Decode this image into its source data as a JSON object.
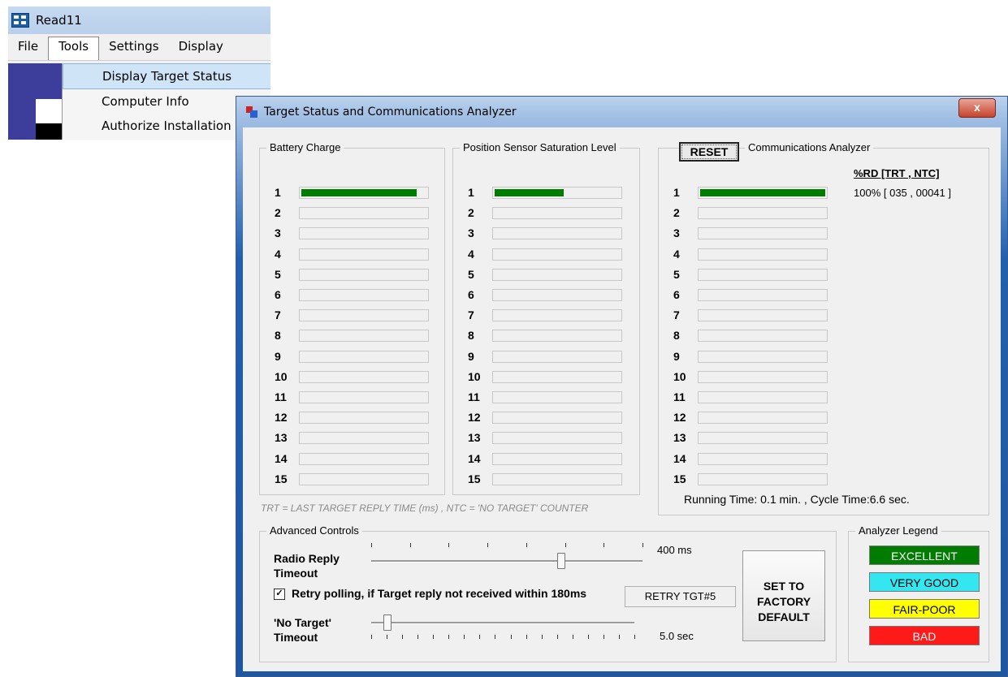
{
  "background_window": {
    "title": "Read11",
    "menu": [
      "File",
      "Tools",
      "Settings",
      "Display"
    ],
    "active_menu": "Tools",
    "dropdown_items": [
      "Display Target Status",
      "Computer Info",
      "Authorize Installation"
    ],
    "selected_item": "Display Target Status"
  },
  "dialog": {
    "title": "Target Status and Communications Analyzer",
    "close_label": "x",
    "battery": {
      "label": "Battery Charge",
      "rows": [
        "1",
        "2",
        "3",
        "4",
        "5",
        "6",
        "7",
        "8",
        "9",
        "10",
        "11",
        "12",
        "13",
        "14",
        "15"
      ],
      "levels": [
        0.92,
        0,
        0,
        0,
        0,
        0,
        0,
        0,
        0,
        0,
        0,
        0,
        0,
        0,
        0
      ]
    },
    "position": {
      "label": "Position Sensor Saturation Level",
      "rows": [
        "1",
        "2",
        "3",
        "4",
        "5",
        "6",
        "7",
        "8",
        "9",
        "10",
        "11",
        "12",
        "13",
        "14",
        "15"
      ],
      "levels": [
        0.55,
        0,
        0,
        0,
        0,
        0,
        0,
        0,
        0,
        0,
        0,
        0,
        0,
        0,
        0
      ]
    },
    "comm": {
      "label": "Communications Analyzer",
      "reset_label": "RESET",
      "rows": [
        "1",
        "2",
        "3",
        "4",
        "5",
        "6",
        "7",
        "8",
        "9",
        "10",
        "11",
        "12",
        "13",
        "14",
        "15"
      ],
      "levels": [
        1.0,
        0,
        0,
        0,
        0,
        0,
        0,
        0,
        0,
        0,
        0,
        0,
        0,
        0,
        0
      ],
      "header": "%RD [TRT ,  NTC]",
      "value": "100% [ 035 , 00041 ]",
      "running": "Running Time: 0.1 min. , Cycle Time:6.6 sec."
    },
    "note": "TRT = LAST TARGET REPLY TIME (ms) , NTC = 'NO TARGET' COUNTER",
    "advanced": {
      "label": "Advanced Controls",
      "radio_label_1": "Radio Reply",
      "radio_label_2": "Timeout",
      "radio_value": "400 ms",
      "radio_level": 0.7,
      "retry_text": "Retry polling, if Target reply not received within 180ms",
      "retry_checked": true,
      "check_mark": "✓",
      "retry_box": "RETRY TGT#5",
      "notarget_label_1": "'No Target'",
      "notarget_label_2": "Timeout",
      "notarget_value": "5.0 sec",
      "notarget_level": 0.03,
      "factory_lines": [
        "SET TO",
        "FACTORY",
        "DEFAULT"
      ]
    },
    "legend": {
      "label": "Analyzer Legend",
      "items": [
        {
          "label": "EXCELLENT",
          "bg": "#007c00",
          "fg": "#ffffff"
        },
        {
          "label": "VERY GOOD",
          "bg": "#33e6f0",
          "fg": "#000000"
        },
        {
          "label": "FAIR-POOR",
          "bg": "#ffff00",
          "fg": "#000000"
        },
        {
          "label": "BAD",
          "bg": "#ff1a1a",
          "fg": "#ffffff"
        }
      ]
    },
    "colors": {
      "bar_fill": "#007c00"
    }
  }
}
